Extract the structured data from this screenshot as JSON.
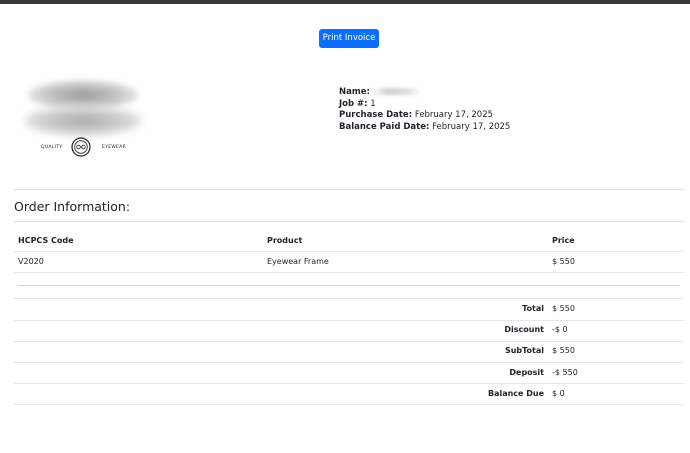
{
  "toolbar": {
    "print_label": "Print Invoice"
  },
  "logo": {
    "word_left": "QUALITY",
    "word_right": "EYEWEAR"
  },
  "customer": {
    "name_label": "Name:",
    "job_label": "Job #:",
    "job_value": "1",
    "purchase_label": "Purchase Date:",
    "purchase_value": "February 17, 2025",
    "balance_paid_label": "Balance Paid Date:",
    "balance_paid_value": "February 17, 2025"
  },
  "order": {
    "title": "Order Information:",
    "headers": {
      "code": "HCPCS Code",
      "product": "Product",
      "price": "Price"
    },
    "items": [
      {
        "code": "V2020",
        "product": "Eyewear Frame",
        "price": "$ 550"
      }
    ]
  },
  "totals": [
    {
      "label": "Total",
      "value": "$ 550"
    },
    {
      "label": "Discount",
      "value": "-$ 0"
    },
    {
      "label": "SubTotal",
      "value": "$ 550"
    },
    {
      "label": "Deposit",
      "value": "-$ 550"
    },
    {
      "label": "Balance Due",
      "value": "$ 0"
    }
  ],
  "colors": {
    "accent": "#0d6efd",
    "border": "#dee2e6"
  }
}
